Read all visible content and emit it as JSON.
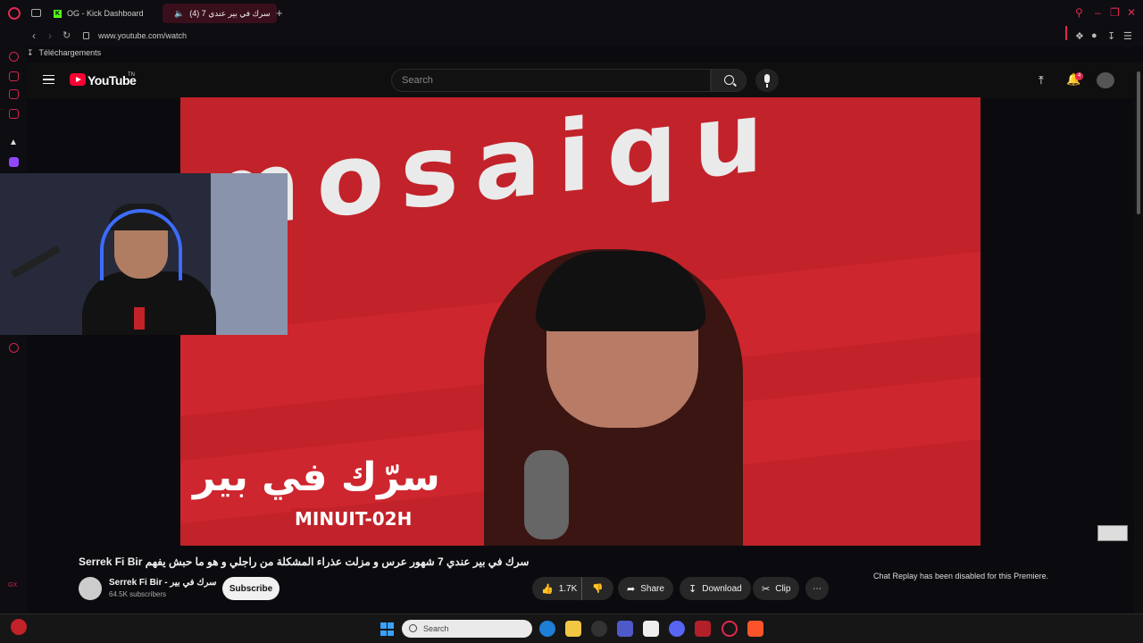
{
  "browser": {
    "tabs": [
      {
        "label": "OG - Kick Dashboard"
      },
      {
        "label": "(4) سرك في بير عندي 7"
      }
    ],
    "url": "www.youtube.com/watch",
    "bookmarks": [
      {
        "label": "Téléchargements"
      }
    ]
  },
  "youtube": {
    "logo_text": "YouTube",
    "logo_sup": "TN",
    "search_placeholder": "Search",
    "notification_count": "4"
  },
  "video": {
    "overlay_title": "سرّك في بير",
    "overlay_tag": "MINUIT-02H",
    "title": "Serrek Fi Bir سرك في بير عندي 7 شهور عرس و مزلت عذراء المشكلة من راجلي و هو ما حبش يفهم",
    "channel_name": "Serrek Fi Bir - سرك في بير",
    "subscribers": "64.5K subscribers",
    "subscribe_label": "Subscribe",
    "like_count": "1.7K",
    "share_label": "Share",
    "download_label": "Download",
    "clip_label": "Clip"
  },
  "chat": {
    "message": "Chat Replay has been disabled for this Premiere."
  },
  "taskbar": {
    "search_label": "Search"
  },
  "colors": {
    "accent": "#e0284f",
    "youtube_red": "#ff0033",
    "video_bg": "#c2222a"
  }
}
